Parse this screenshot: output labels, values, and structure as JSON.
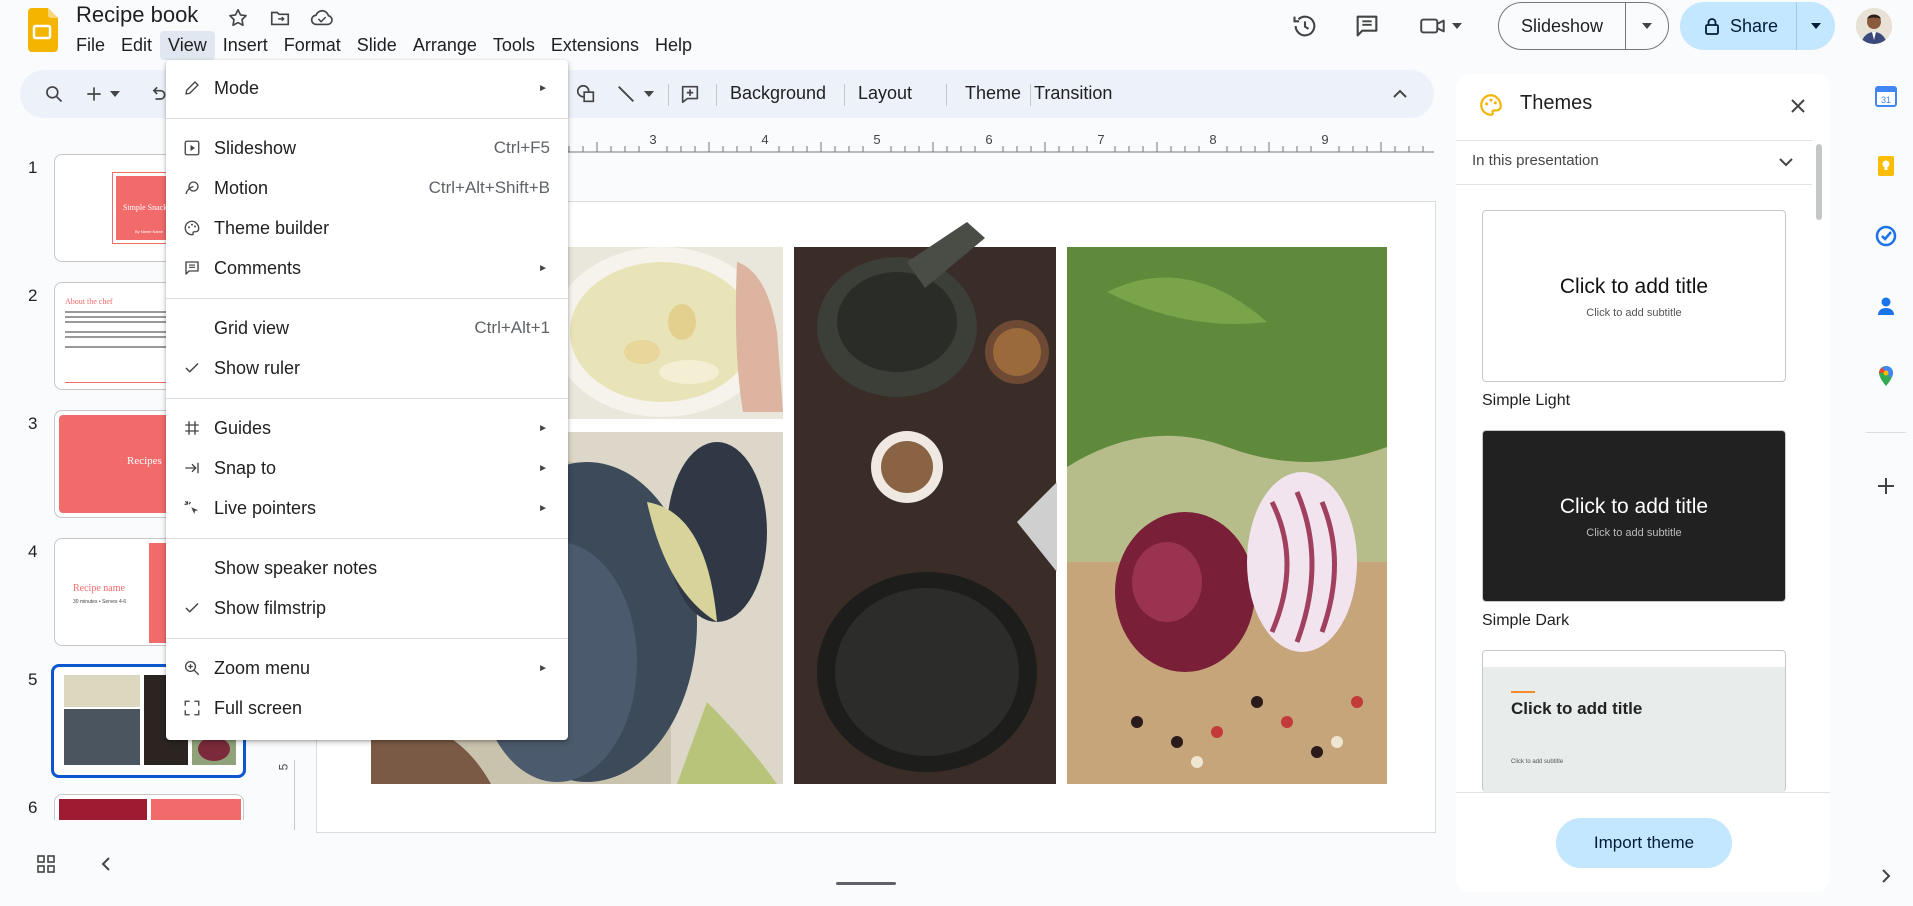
{
  "app": {
    "title": "Recipe book",
    "menu": [
      "File",
      "Edit",
      "View",
      "Insert",
      "Format",
      "Slide",
      "Arrange",
      "Tools",
      "Extensions",
      "Help"
    ],
    "active_menu": "View"
  },
  "header": {
    "slideshow_label": "Slideshow",
    "share_label": "Share"
  },
  "toolbar": {
    "background_label": "Background",
    "layout_label": "Layout",
    "theme_label": "Theme",
    "transition_label": "Transition"
  },
  "ruler": {
    "marks": [
      "3",
      "4",
      "5",
      "6",
      "7",
      "8",
      "9"
    ],
    "vertical_mark": "5"
  },
  "filmstrip": {
    "slides": [
      {
        "num": "1",
        "title": "Simple Snacks",
        "subtitle": "By Name Name"
      },
      {
        "num": "2",
        "title": "About the chef"
      },
      {
        "num": "3",
        "title": "Recipes"
      },
      {
        "num": "4",
        "title": "Recipe name",
        "subtitle": "30 minutes • Serves 4-6"
      },
      {
        "num": "5"
      },
      {
        "num": "6"
      }
    ],
    "selected": "5"
  },
  "view_menu": {
    "items": [
      {
        "label": "Mode",
        "icon": "pencil-icon",
        "submenu": true
      },
      {
        "label": "Slideshow",
        "icon": "slideshow-icon",
        "shortcut": "Ctrl+F5"
      },
      {
        "label": "Motion",
        "icon": "motion-icon",
        "shortcut": "Ctrl+Alt+Shift+B"
      },
      {
        "label": "Theme builder",
        "icon": "palette-icon"
      },
      {
        "label": "Comments",
        "icon": "comment-icon",
        "submenu": true
      },
      {
        "label": "Grid view",
        "shortcut": "Ctrl+Alt+1"
      },
      {
        "label": "Show ruler",
        "checked": true
      },
      {
        "label": "Guides",
        "icon": "grid-icon",
        "submenu": true
      },
      {
        "label": "Snap to",
        "icon": "snap-icon",
        "submenu": true
      },
      {
        "label": "Live pointers",
        "icon": "pointer-icon",
        "submenu": true
      },
      {
        "label": "Show speaker notes"
      },
      {
        "label": "Show filmstrip",
        "checked": true
      },
      {
        "label": "Zoom menu",
        "icon": "zoom-icon",
        "submenu": true
      },
      {
        "label": "Full screen",
        "icon": "fullscreen-icon"
      }
    ]
  },
  "themes_panel": {
    "title": "Themes",
    "filter": "In this presentation",
    "themes": [
      {
        "name": "Simple Light",
        "card_title": "Click to add title",
        "card_subtitle": "Click to add subtitle"
      },
      {
        "name": "Simple Dark",
        "card_title": "Click to add title",
        "card_subtitle": "Click to add subtitle"
      },
      {
        "name": "",
        "card_title": "Click to add title",
        "card_subtitle": "Click to add subtitle"
      }
    ],
    "import_label": "Import theme"
  },
  "colors": {
    "accent": "#0b57d0",
    "share_bg": "#c2e7ff",
    "slides_yellow": "#f4b400",
    "coral": "#f26b6b"
  }
}
